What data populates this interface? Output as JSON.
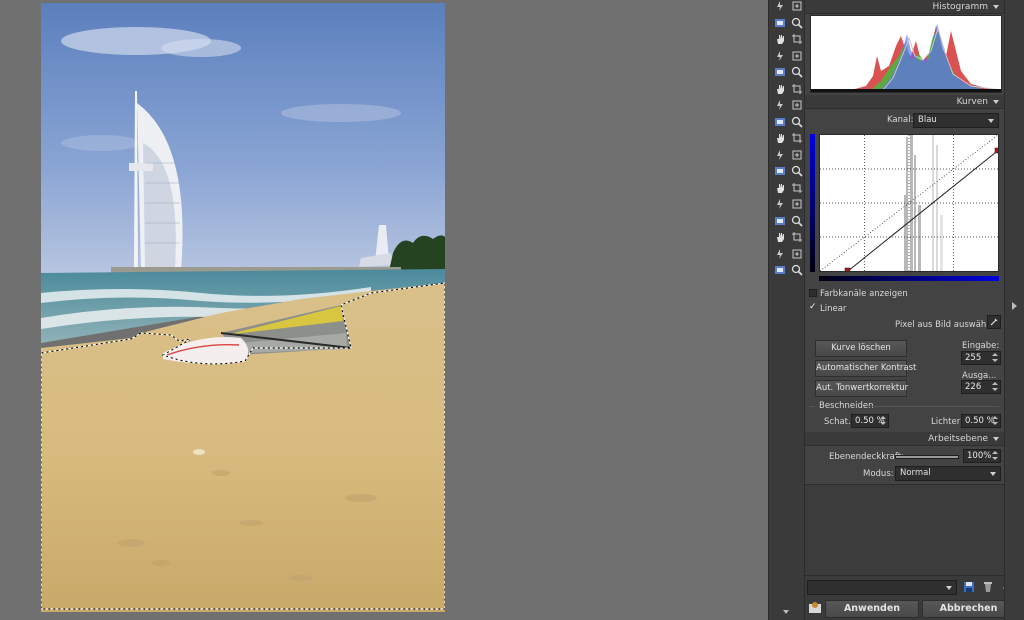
{
  "panel": {
    "histogram": {
      "title": "Histogramm"
    },
    "curves": {
      "title": "Kurven",
      "channel_label": "Kanal:",
      "channel_value": "Blau",
      "show_channels_label": "Farbkanäle anzeigen",
      "linear_label": "Linear",
      "linear_checked": true,
      "pick_pixel_label": "Pixel aus Bild auswählen:",
      "clear_curve": "Kurve löschen",
      "auto_contrast": "Automatischer Kontrast",
      "auto_tone": "Aut. Tonwertkorrektur",
      "input_label": "Eingabe:",
      "input_value": "255",
      "output_label": "Ausga...",
      "output_value": "226",
      "clip_title": "Beschneiden",
      "shadows_label": "Schat.:",
      "shadows_value": "0.50 %",
      "highlights_label": "Lichter:",
      "highlights_value": "0.50 %",
      "curve_end_output": 226
    },
    "layer": {
      "title": "Arbeitsebene",
      "opacity_label": "Ebenendeckkraft:",
      "opacity_value": "100%",
      "opacity_level": 1.0,
      "mode_label": "Modus:",
      "mode_value": "Normal"
    },
    "footer": {
      "apply": "Anwenden",
      "cancel": "Abbrechen",
      "preset_value": ""
    }
  },
  "colors": {
    "panel_bg": "#434343",
    "header_bg": "#3a3a3a",
    "canvas_bg": "#707070",
    "blue_channel": "#0000c8",
    "curve_point": "#b01818"
  },
  "toolbar_icons": [
    "lightning-icon",
    "move-icon",
    "navigator-icon",
    "zoom-icon",
    "hand-icon",
    "crop-icon",
    "straighten-icon",
    "perspective-icon",
    "transform-icon",
    "warp-icon",
    "resize-icon",
    "rotate-icon",
    "person-icon",
    "red-eye-icon",
    "brush-icon",
    "clone-icon",
    "pen-icon",
    "eraser-icon",
    "smudge-icon",
    "rect-select-icon",
    "ellipse-select-icon",
    "lasso-icon",
    "magic-wand-icon",
    "magnetic-lasso-icon",
    "smart-select-icon",
    "brush-select-icon",
    "layer-icon",
    "mask-icon",
    "text-icon",
    "shape-icon",
    "line-icon",
    "gradient-icon",
    "fill-icon",
    "picker-icon"
  ]
}
